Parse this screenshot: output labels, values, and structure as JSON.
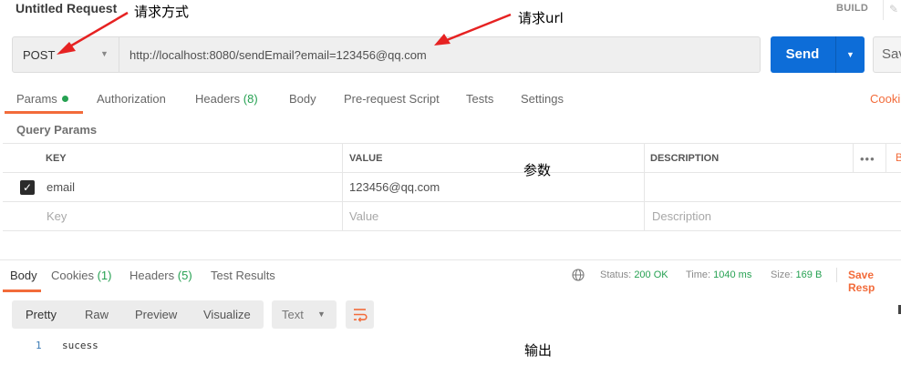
{
  "request": {
    "title": "Untitled Request",
    "build_label": "BUILD",
    "method": "POST",
    "url": "http://localhost:8080/sendEmail?email=123456@qq.com",
    "send_label": "Send",
    "save_label": "Sav"
  },
  "request_tabs": [
    {
      "label": "Params"
    },
    {
      "label": "Authorization"
    },
    {
      "label": "Headers",
      "count": "(8)"
    },
    {
      "label": "Body"
    },
    {
      "label": "Pre-request Script"
    },
    {
      "label": "Tests"
    },
    {
      "label": "Settings"
    }
  ],
  "cookies_link": "Cooki",
  "params": {
    "section_title": "Query Params",
    "columns": [
      "KEY",
      "VALUE",
      "DESCRIPTION"
    ],
    "more_label": "•••",
    "bulk_label": "B",
    "rows": [
      {
        "checked": true,
        "key": "email",
        "value": "123456@qq.com",
        "description": ""
      }
    ],
    "placeholders": {
      "key": "Key",
      "value": "Value",
      "description": "Description"
    }
  },
  "response_tabs": [
    {
      "label": "Body"
    },
    {
      "label": "Cookies",
      "count": "(1)"
    },
    {
      "label": "Headers",
      "count": "(5)"
    },
    {
      "label": "Test Results"
    }
  ],
  "response_meta": {
    "status_label": "Status:",
    "status_value": "200 OK",
    "time_label": "Time:",
    "time_value": "1040 ms",
    "size_label": "Size:",
    "size_value": "169 B",
    "save_response": "Save Resp"
  },
  "view_modes": [
    "Pretty",
    "Raw",
    "Preview",
    "Visualize"
  ],
  "format": "Text",
  "response_body": {
    "line_number": "1",
    "content": "sucess"
  },
  "annotations": {
    "method_note": "请求方式",
    "url_note": "请求url",
    "params_note": "参数",
    "output_note": "输出"
  },
  "colors": {
    "accent": "#f26b3a",
    "send": "#0d6dd8",
    "success": "#26a152"
  }
}
